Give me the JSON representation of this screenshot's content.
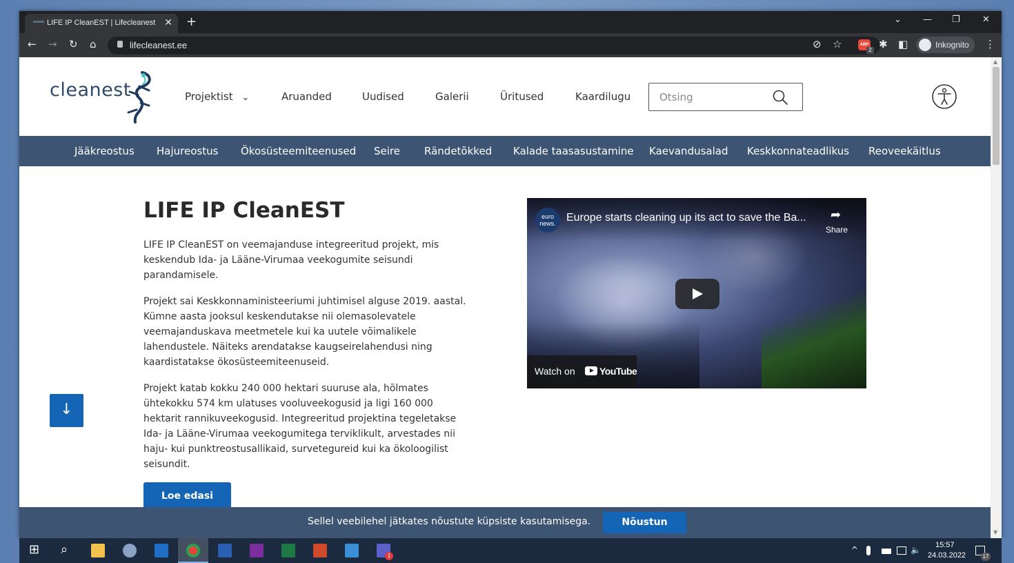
{
  "browser": {
    "tab_title": "LIFE IP CleanEST | Lifecleanest",
    "tab_close": "✕",
    "new_tab": "+",
    "url": "lifecleanest.ee",
    "incognito_label": "Inkognito",
    "abp_label": "ABP",
    "abp_badge": "2",
    "controls": {
      "chevron": "⌄",
      "minimize": "—",
      "restore": "❐",
      "close": "✕"
    },
    "toolbar_icons": {
      "back": "←",
      "forward": "→",
      "reload": "↻",
      "home": "⌂",
      "eye_off": "⊘",
      "star": "☆",
      "puzzle": "✱",
      "sidepanel": "◧",
      "menu": "⋮"
    }
  },
  "site": {
    "logo_text": "cleanest",
    "nav": [
      {
        "label": "Projektist",
        "has_dropdown": true
      },
      {
        "label": "Aruanded"
      },
      {
        "label": "Uudised"
      },
      {
        "label": "Galerii"
      },
      {
        "label": "Üritused"
      },
      {
        "label": "Kaardilugu"
      }
    ],
    "dropdown_caret": "⌄",
    "search_placeholder": "Otsing",
    "subnav": [
      "Jääkreostus",
      "Hajureostus",
      "Ökosüsteemiteenused",
      "Seire",
      "Rändetõkked",
      "Kalade taasasustamine",
      "Kaevandusalad",
      "Keskkonnateadlikus",
      "Reoveekäitlus"
    ]
  },
  "content": {
    "title": "LIFE IP CleanEST",
    "paragraphs": [
      "LIFE IP CleanEST on veemajanduse integreeritud projekt, mis keskendub Ida- ja Lääne-Virumaa veekogumite seisundi parandamisele.",
      "Projekt sai Keskkonnaministeeriumi juhtimisel alguse 2019. aastal. Kümne aasta jooksul keskendutakse nii olemasolevatele veemajanduskava meetmetele kui ka uutele võimalikele lahendustele. Näiteks arendatakse kaugseirelahendusi ning kaardistatakse ökosüsteemiteenuseid.",
      "Projekt katab kokku 240 000 hektari suuruse ala, hõlmates ühtekokku 574 km ulatuses vooluveekogusid ja ligi 160 000 hektarit rannikuveekogusid. Integreeritud projektina tegeletakse Ida- ja Lääne-Virumaa veekogumitega terviklikult, arvestades nii haju- kui punktreostusallikaid, survetegureid kui ka ökoloogilist seisundit."
    ],
    "read_more": "Loe edasi",
    "scroll_down": "↓"
  },
  "video": {
    "channel_logo": "euro news.",
    "title": "Europe starts cleaning up its act to save the Ba...",
    "share_icon": "➦",
    "share_label": "Share",
    "watch_on": "Watch on",
    "youtube": "YouTube"
  },
  "cookie": {
    "text": "Sellel veebilehel jätkates nõustute küpsiste kasutamisega.",
    "button": "Nõustun"
  },
  "taskbar": {
    "start": "⊞",
    "search": "⌕",
    "time": "15:57",
    "date": "24.03.2022",
    "tray_chevron": "^",
    "volume": "🔈",
    "notifications_count": "17",
    "teams_badge": "1"
  }
}
